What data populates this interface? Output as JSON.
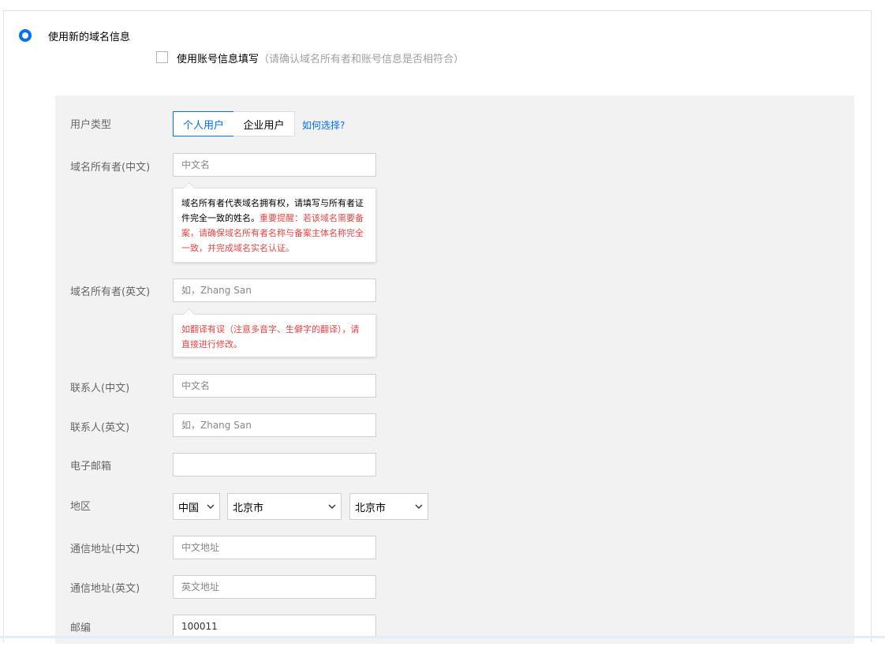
{
  "option": {
    "label": "使用新的域名信息"
  },
  "account_fill": {
    "label": "使用账号信息填写",
    "hint": "（请确认域名所有者和账号信息是否相符合）"
  },
  "user_type": {
    "label": "用户类型",
    "options": [
      "个人用户",
      "企业用户"
    ],
    "selected": "个人用户",
    "help_link": "如何选择?"
  },
  "owner_cn": {
    "label": "域名所有者(中文)",
    "placeholder": "中文名",
    "tip_normal": "域名所有者代表域名拥有权，请填写与所有者证件完全一致的姓名。",
    "tip_warning": "重要提醒：若该域名需要备案，请确保域名所有者名称与备案主体名称完全一致，并完成域名实名认证。"
  },
  "owner_en": {
    "label": "域名所有者(英文)",
    "placeholder": "如，Zhang San",
    "tip_warning": "如翻译有误（注意多音字、生僻字的翻译），请直接进行修改。"
  },
  "contact_cn": {
    "label": "联系人(中文)",
    "placeholder": "中文名"
  },
  "contact_en": {
    "label": "联系人(英文)",
    "placeholder": "如，Zhang San"
  },
  "email": {
    "label": "电子邮箱",
    "value": ""
  },
  "region": {
    "label": "地区",
    "country": "中国",
    "province": "北京市",
    "city": "北京市"
  },
  "address_cn": {
    "label": "通信地址(中文)",
    "placeholder": "中文地址"
  },
  "address_en": {
    "label": "通信地址(英文)",
    "placeholder": "英文地址"
  },
  "postcode": {
    "label": "邮编",
    "value": "100011"
  },
  "colors": {
    "accent": "#006eff",
    "warning": "#e54545",
    "panel_bg": "#f2f2f2"
  }
}
